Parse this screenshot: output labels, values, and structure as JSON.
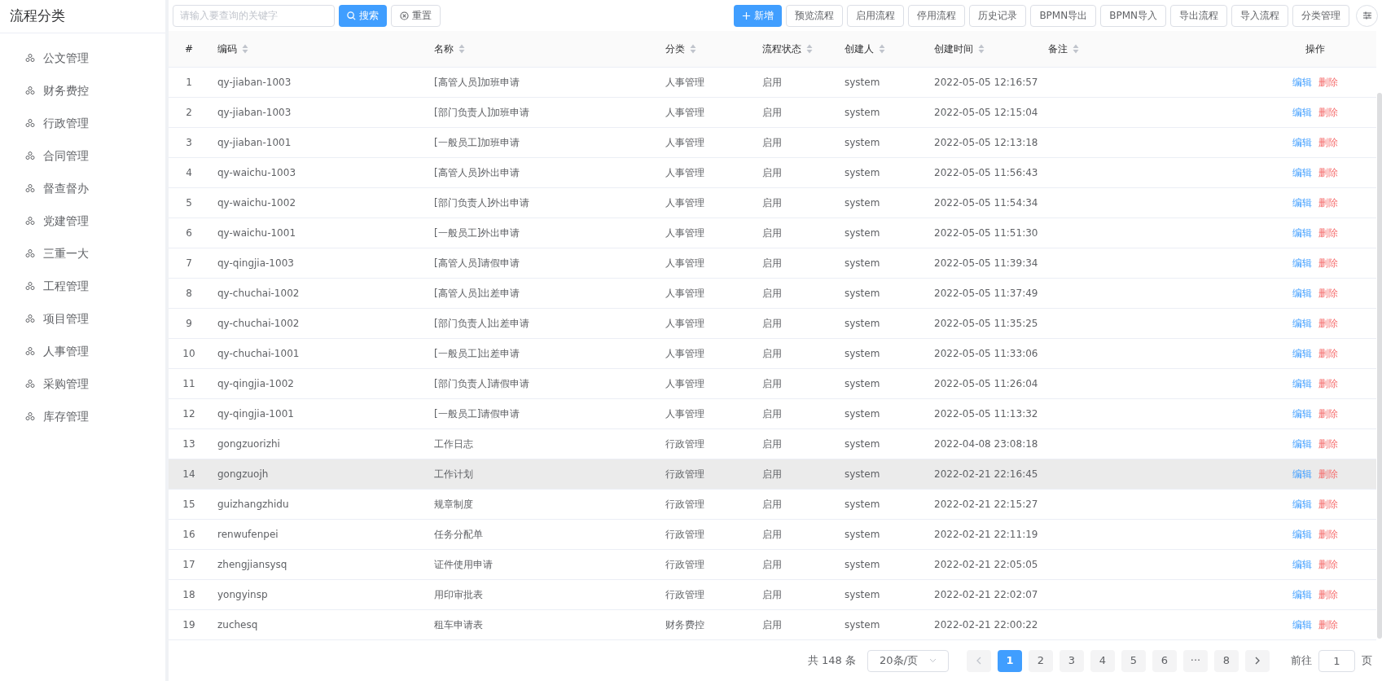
{
  "sidebar": {
    "title": "流程分类",
    "items": [
      {
        "label": "公文管理"
      },
      {
        "label": "财务费控"
      },
      {
        "label": "行政管理"
      },
      {
        "label": "合同管理"
      },
      {
        "label": "督查督办"
      },
      {
        "label": "党建管理"
      },
      {
        "label": "三重一大"
      },
      {
        "label": "工程管理"
      },
      {
        "label": "项目管理"
      },
      {
        "label": "人事管理"
      },
      {
        "label": "采购管理"
      },
      {
        "label": "库存管理"
      }
    ]
  },
  "toolbar": {
    "search": {
      "placeholder": "请输入要查询的关键字"
    },
    "search_button": "搜索",
    "reset_button": "重置",
    "add_button": "新增",
    "buttons": [
      "预览流程",
      "启用流程",
      "停用流程",
      "历史记录",
      "BPMN导出",
      "BPMN导入",
      "导出流程",
      "导入流程",
      "分类管理"
    ]
  },
  "table": {
    "columns": [
      {
        "label": "#",
        "sortable": false
      },
      {
        "label": "编码",
        "sortable": true
      },
      {
        "label": "名称",
        "sortable": true
      },
      {
        "label": "分类",
        "sortable": true
      },
      {
        "label": "流程状态",
        "sortable": true
      },
      {
        "label": "创建人",
        "sortable": true
      },
      {
        "label": "创建时间",
        "sortable": true
      },
      {
        "label": "备注",
        "sortable": true
      },
      {
        "label": "操作",
        "sortable": false
      }
    ],
    "rows": [
      {
        "selected": false,
        "cells": [
          "1",
          "qy-jiaban-1003",
          "[高管人员]加班申请",
          "人事管理",
          "启用",
          "system",
          "2022-05-05 12:16:57"
        ],
        "actions": [
          "编辑",
          "删除"
        ]
      },
      {
        "selected": false,
        "cells": [
          "2",
          "qy-jiaban-1003",
          "[部门负责人]加班申请",
          "人事管理",
          "启用",
          "system",
          "2022-05-05 12:15:04"
        ],
        "actions": [
          "编辑",
          "删除"
        ]
      },
      {
        "selected": false,
        "cells": [
          "3",
          "qy-jiaban-1001",
          "[一般员工]加班申请",
          "人事管理",
          "启用",
          "system",
          "2022-05-05 12:13:18"
        ],
        "actions": [
          "编辑",
          "删除"
        ]
      },
      {
        "selected": false,
        "cells": [
          "4",
          "qy-waichu-1003",
          "[高管人员]外出申请",
          "人事管理",
          "启用",
          "system",
          "2022-05-05 11:56:43"
        ],
        "actions": [
          "编辑",
          "删除"
        ]
      },
      {
        "selected": false,
        "cells": [
          "5",
          "qy-waichu-1002",
          "[部门负责人]外出申请",
          "人事管理",
          "启用",
          "system",
          "2022-05-05 11:54:34"
        ],
        "actions": [
          "编辑",
          "删除"
        ]
      },
      {
        "selected": false,
        "cells": [
          "6",
          "qy-waichu-1001",
          "[一般员工]外出申请",
          "人事管理",
          "启用",
          "system",
          "2022-05-05 11:51:30"
        ],
        "actions": [
          "编辑",
          "删除"
        ]
      },
      {
        "selected": false,
        "cells": [
          "7",
          "qy-qingjia-1003",
          "[高管人员]请假申请",
          "人事管理",
          "启用",
          "system",
          "2022-05-05 11:39:34"
        ],
        "actions": [
          "编辑",
          "删除"
        ]
      },
      {
        "selected": false,
        "cells": [
          "8",
          "qy-chuchai-1002",
          "[高管人员]出差申请",
          "人事管理",
          "启用",
          "system",
          "2022-05-05 11:37:49"
        ],
        "actions": [
          "编辑",
          "删除"
        ]
      },
      {
        "selected": false,
        "cells": [
          "9",
          "qy-chuchai-1002",
          "[部门负责人]出差申请",
          "人事管理",
          "启用",
          "system",
          "2022-05-05 11:35:25"
        ],
        "actions": [
          "编辑",
          "删除"
        ]
      },
      {
        "selected": false,
        "cells": [
          "10",
          "qy-chuchai-1001",
          "[一般员工]出差申请",
          "人事管理",
          "启用",
          "system",
          "2022-05-05 11:33:06"
        ],
        "actions": [
          "编辑",
          "删除"
        ]
      },
      {
        "selected": false,
        "cells": [
          "11",
          "qy-qingjia-1002",
          "[部门负责人]请假申请",
          "人事管理",
          "启用",
          "system",
          "2022-05-05 11:26:04"
        ],
        "actions": [
          "编辑",
          "删除"
        ]
      },
      {
        "selected": false,
        "cells": [
          "12",
          "qy-qingjia-1001",
          "[一般员工]请假申请",
          "人事管理",
          "启用",
          "system",
          "2022-05-05 11:13:32"
        ],
        "actions": [
          "编辑",
          "删除"
        ]
      },
      {
        "selected": false,
        "cells": [
          "13",
          "gongzuorizhi",
          "工作日志",
          "行政管理",
          "启用",
          "system",
          "2022-04-08 23:08:18"
        ],
        "actions": [
          "编辑",
          "删除"
        ]
      },
      {
        "selected": true,
        "cells": [
          "14",
          "gongzuojh",
          "工作计划",
          "行政管理",
          "启用",
          "system",
          "2022-02-21 22:16:45"
        ],
        "actions": [
          "编辑",
          "删除"
        ]
      },
      {
        "selected": false,
        "cells": [
          "15",
          "guizhangzhidu",
          "规章制度",
          "行政管理",
          "启用",
          "system",
          "2022-02-21 22:15:27"
        ],
        "actions": [
          "编辑",
          "删除"
        ]
      },
      {
        "selected": false,
        "cells": [
          "16",
          "renwufenpei",
          "任务分配单",
          "行政管理",
          "启用",
          "system",
          "2022-02-21 22:11:19"
        ],
        "actions": [
          "编辑",
          "删除"
        ]
      },
      {
        "selected": false,
        "cells": [
          "17",
          "zhengjiansysq",
          "证件使用申请",
          "行政管理",
          "启用",
          "system",
          "2022-02-21 22:05:05"
        ],
        "actions": [
          "编辑",
          "删除"
        ]
      },
      {
        "selected": false,
        "cells": [
          "18",
          "yongyinsp",
          "用印审批表",
          "行政管理",
          "启用",
          "system",
          "2022-02-21 22:02:07"
        ],
        "actions": [
          "编辑",
          "删除"
        ]
      },
      {
        "selected": false,
        "cells": [
          "19",
          "zuchesq",
          "租车申请表",
          "财务费控",
          "启用",
          "system",
          "2022-02-21 22:00:22"
        ],
        "actions": [
          "编辑",
          "删除"
        ]
      }
    ]
  },
  "pagination": {
    "total": "共 148 条",
    "page_size": "20条/页",
    "pages": [
      {
        "label": "1",
        "selected": true
      },
      {
        "label": "2",
        "selected": false
      },
      {
        "label": "3",
        "selected": false
      },
      {
        "label": "4",
        "selected": false
      },
      {
        "label": "5",
        "selected": false
      },
      {
        "label": "6",
        "selected": false
      },
      {
        "label": "···",
        "selected": false
      },
      {
        "label": "8",
        "selected": false
      }
    ],
    "goto_label": "前往",
    "goto_value": "1",
    "page_suffix": "页"
  }
}
